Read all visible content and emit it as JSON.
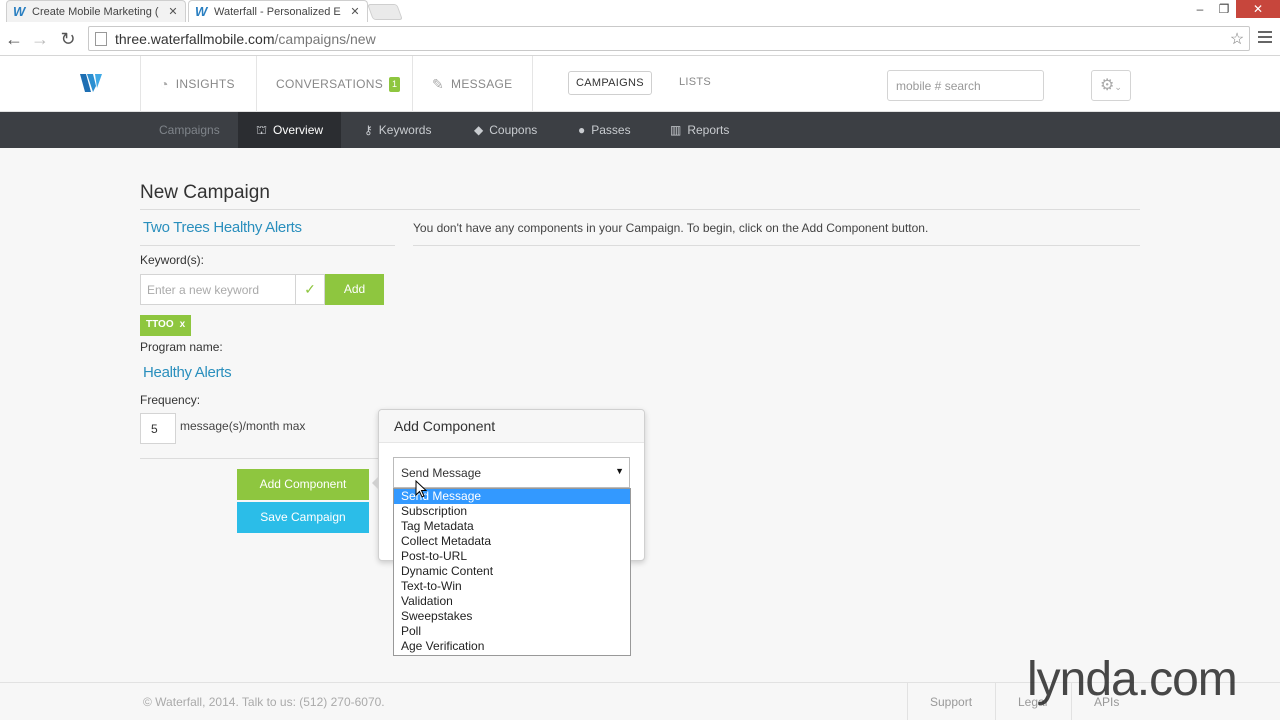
{
  "browser": {
    "tabs": [
      {
        "title": "Create Mobile Marketing ("
      },
      {
        "title": "Waterfall - Personalized E"
      }
    ],
    "url_host": "three.waterfallmobile.com",
    "url_path": "/campaigns/new"
  },
  "header": {
    "nav": {
      "insights": "INSIGHTS",
      "conversations": "CONVERSATIONS",
      "conversations_badge": "1",
      "message": "MESSAGE",
      "campaigns": "CAMPAIGNS",
      "lists": "LISTS"
    },
    "search_placeholder": "mobile # search"
  },
  "subnav": {
    "items": [
      {
        "label": "Campaigns"
      },
      {
        "label": "Overview"
      },
      {
        "label": "Keywords"
      },
      {
        "label": "Coupons"
      },
      {
        "label": "Passes"
      },
      {
        "label": "Reports"
      }
    ]
  },
  "page": {
    "title": "New Campaign",
    "campaign_name": "Two Trees Healthy Alerts",
    "notice": "You don't have any components in your Campaign. To begin, click on the Add Component button.",
    "keywords_label": "Keyword(s):",
    "keyword_placeholder": "Enter a new keyword",
    "check": "✓",
    "add_label": "Add",
    "keyword_tag": "TTOO",
    "tag_remove": "x",
    "program_label": "Program name:",
    "program_name": "Healthy Alerts",
    "frequency_label": "Frequency:",
    "frequency_value": "5",
    "frequency_unit": "message(s)/month max",
    "add_component": "Add Component",
    "save_campaign": "Save Campaign"
  },
  "popover": {
    "title": "Add Component",
    "selected": "Send Message",
    "options": [
      "Send Message",
      "Subscription",
      "Tag Metadata",
      "Collect Metadata",
      "Post-to-URL",
      "Dynamic Content",
      "Text-to-Win",
      "Validation",
      "Sweepstakes",
      "Poll",
      "Age Verification"
    ]
  },
  "footer": {
    "copyright": "© Waterfall, 2014. Talk to us: (512) 270-6070.",
    "support": "Support",
    "legal": "Legal",
    "apis": "APIs"
  },
  "watermark": "lynda.com",
  "colors": {
    "accent_green": "#8ec63f",
    "accent_blue": "#2bbde8",
    "link_blue": "#2a8fbd",
    "subnav_bg": "#3c3f44"
  }
}
